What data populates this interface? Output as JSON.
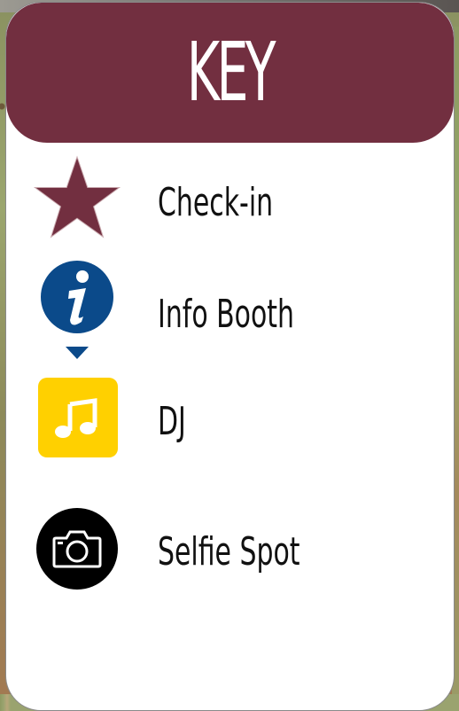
{
  "key": {
    "title": "KEY",
    "header_color": "#722f40",
    "items": [
      {
        "label": "Check-in",
        "icon": "star-icon",
        "color": "#722f40"
      },
      {
        "label": "Info Booth",
        "icon": "info-pin-icon",
        "color": "#0b4a8a"
      },
      {
        "label": "DJ",
        "icon": "music-note-icon",
        "color": "#ffd000"
      },
      {
        "label": "Selfie Spot",
        "icon": "camera-icon",
        "color": "#000000"
      }
    ]
  }
}
